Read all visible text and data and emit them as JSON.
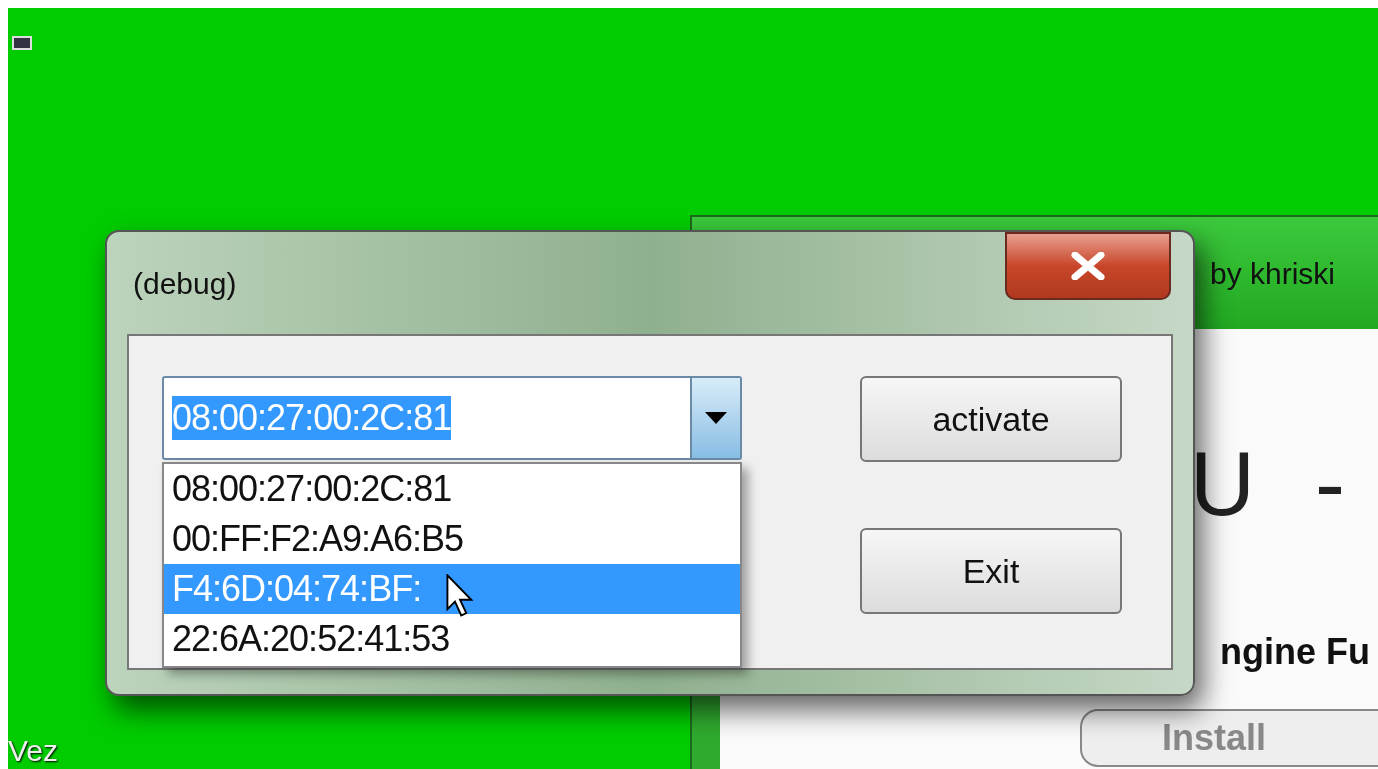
{
  "desktop": {
    "icon_label": "Vez"
  },
  "background_window": {
    "title": "by khriski",
    "heading": [
      "U",
      "-"
    ],
    "subheading": "ngine Fu",
    "button": "Install"
  },
  "dialog": {
    "title": "(debug)",
    "combo": {
      "value": "08:00:27:00:2C:81",
      "text_selected": true,
      "expanded": true
    },
    "options": [
      {
        "label": "08:00:27:00:2C:81",
        "selected": false
      },
      {
        "label": "00:FF:F2:A9:A6:B5",
        "selected": false
      },
      {
        "label": "F4:6D:04:74:BF:",
        "selected": true
      },
      {
        "label": "22:6A:20:52:41:53",
        "selected": false
      }
    ],
    "buttons": [
      "activate",
      "Exit"
    ]
  }
}
